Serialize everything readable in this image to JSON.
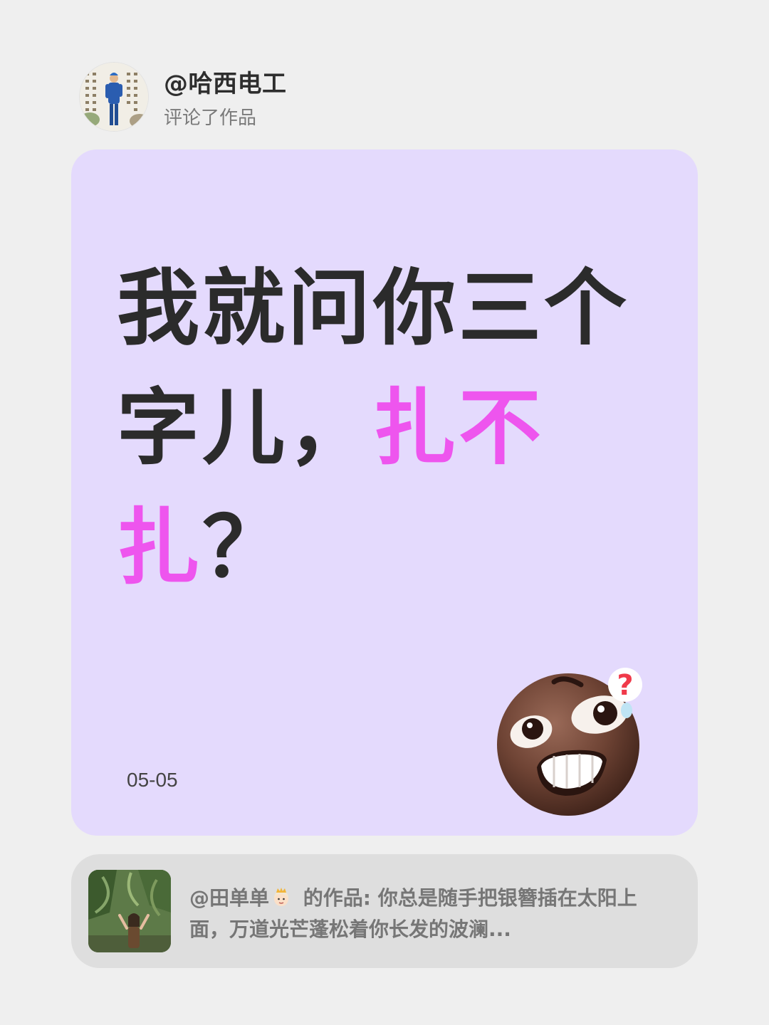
{
  "header": {
    "username": "@哈西电工",
    "action": "评论了作品"
  },
  "comment": {
    "line1": "我就问你三个",
    "line2_prefix": "字儿，",
    "line2_highlight": "扎不",
    "line3_highlight": "扎",
    "line3_suffix": "？",
    "highlight_color": "#ee55ee",
    "date": "05-05"
  },
  "referenced_work": {
    "author": "@田单单",
    "author_emoji": "princess-icon",
    "label": "的作品:",
    "excerpt": "你总是随手把银簪插在太阳上面，万道光芒蓬松着你长发的波澜..."
  },
  "colors": {
    "background": "#efefef",
    "card": "#e4dafd",
    "ref_card": "#dedede",
    "text_dark": "#2b2b2b",
    "text_muted": "#767676"
  }
}
